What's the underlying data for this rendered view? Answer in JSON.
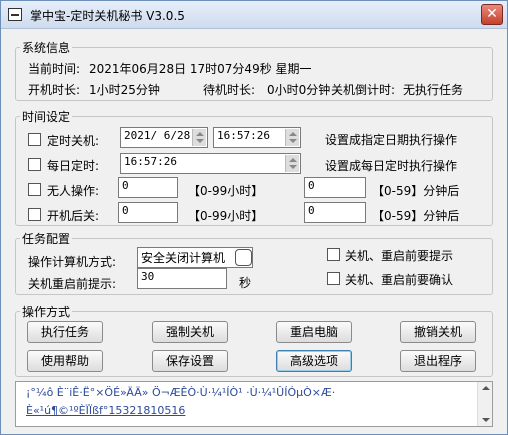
{
  "window": {
    "title": "掌中宝-定时关机秘书 V3.0.5",
    "close_label": "✕"
  },
  "system_info": {
    "legend": "系统信息",
    "current_time_label": "当前时间:",
    "current_time_value": "2021年06月28日 17时07分49秒 星期一",
    "uptime_label": "开机时长:",
    "uptime_value": "1小时25分钟",
    "standby_label": "待机时长:",
    "standby_value": "0小时0分钟",
    "countdown_label": "关机倒计时:",
    "countdown_value": "无执行任务"
  },
  "time_settings": {
    "legend": "时间设定",
    "scheduled_shutdown": {
      "label": "定时关机:",
      "date": "2021/ 6/28",
      "time": "16:57:26",
      "note": "设置成指定日期执行操作"
    },
    "daily_schedule": {
      "label": "每日定时:",
      "time": "16:57:26",
      "note": "设置成每日定时执行操作"
    },
    "idle": {
      "label": "无人操作:",
      "hours": "0",
      "hours_range": "【0-99小时】",
      "minutes": "0",
      "minutes_range": "【0-59】分钟后"
    },
    "after_boot": {
      "label": "开机后关:",
      "hours": "0",
      "hours_range": "【0-99小时】",
      "minutes": "0",
      "minutes_range": "【0-59】分钟后"
    }
  },
  "task_config": {
    "legend": "任务配置",
    "action_label": "操作计算机方式:",
    "action_value": "安全关闭计算机",
    "reminder_label": "关机重启前提示:",
    "reminder_value": "30",
    "reminder_unit": "秒",
    "prompt_label": "关机、重启前要提示",
    "confirm_label": "关机、重启前要确认"
  },
  "operations": {
    "legend": "操作方式",
    "buttons": [
      "执行任务",
      "强制关机",
      "重启电脑",
      "撤销关机",
      "使用帮助",
      "保存设置",
      "高级选项",
      "退出程序"
    ]
  },
  "marquee": {
    "line1": "¡°¼ô È¨iÊ·Ë°×ÖÉ»ÄÄ» Ö¬ÆÊÒ·Ù·¼¹ÍÒ¹ ·Ù·¼¹ÛÍÓµÒ×Æ·",
    "line2": "È«¹ú¶©¹ºÈÏÏßf°15321810516"
  }
}
